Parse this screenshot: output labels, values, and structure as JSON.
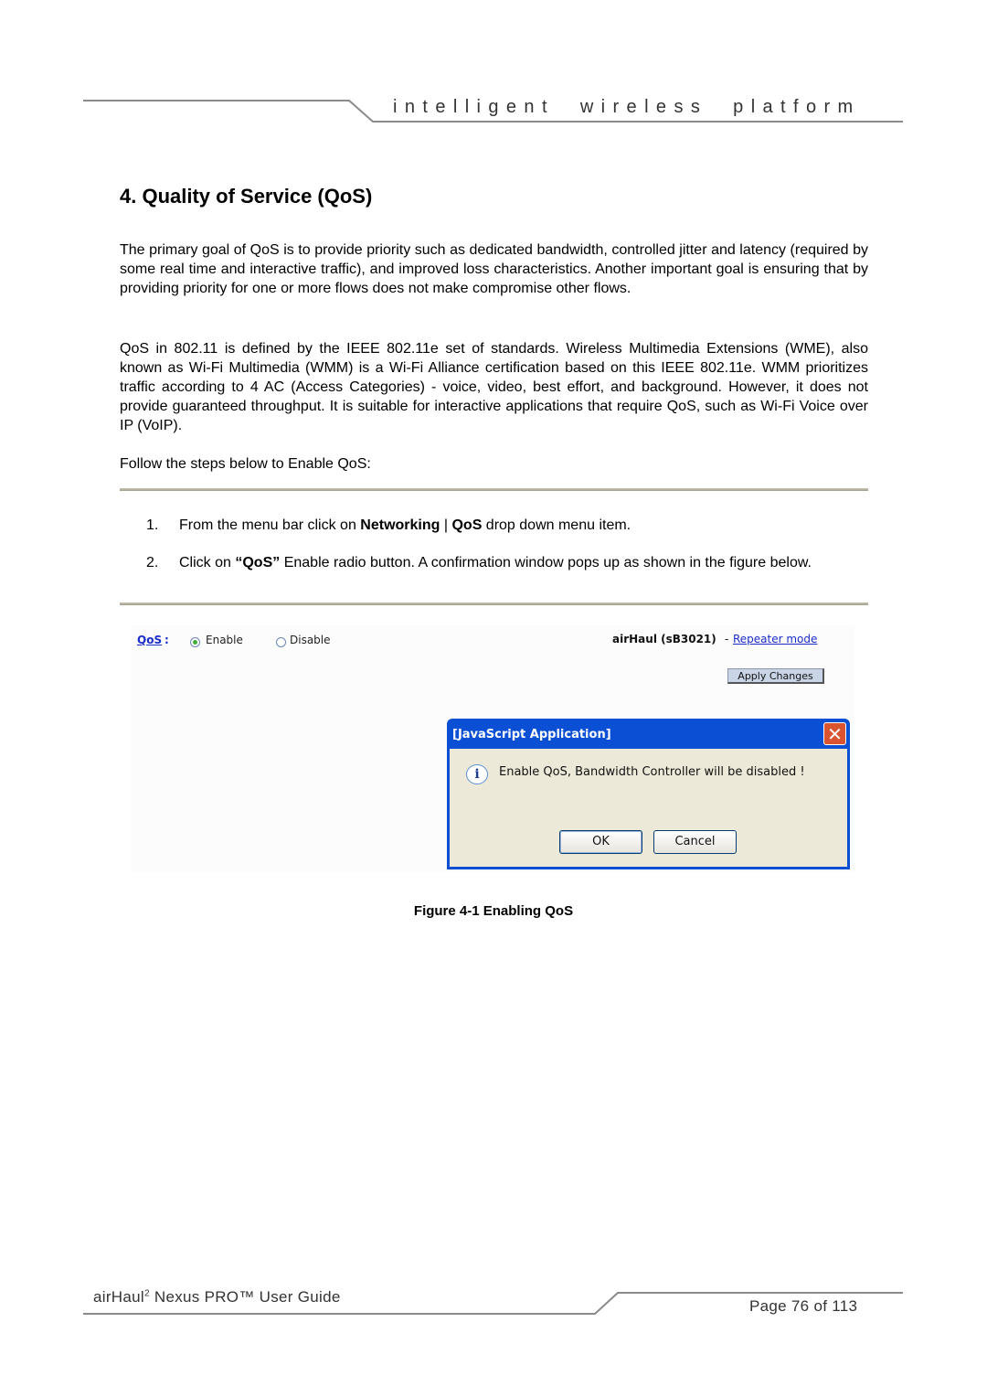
{
  "header": {
    "tagline": "intelligent  wireless  platform"
  },
  "section": {
    "title": "4. Quality of Service (QoS)",
    "paragraphs": [
      "The primary goal of QoS is to provide priority such as dedicated bandwidth, controlled jitter and latency (required by some real time and interactive traffic), and improved loss characteristics. Another important goal is ensuring that by providing priority for one or more flows does not make compromise other flows.",
      "QoS in 802.11 is defined by the IEEE 802.11e set of standards. Wireless Multimedia Extensions (WME), also known as Wi-Fi Multimedia (WMM) is a Wi-Fi Alliance certification based on this IEEE 802.11e. WMM prioritizes traffic according to 4 AC (Access Categories) - voice, video, best effort, and background. However, it does not provide guaranteed throughput. It is suitable for interactive applications that require QoS, such as Wi-Fi Voice over IP (VoIP).",
      "Follow the steps below to Enable QoS:"
    ],
    "steps": [
      {
        "num": "1.",
        "pre": "From the menu bar click on ",
        "bold1": "Networking",
        "sep": " | ",
        "bold2": "QoS",
        "post": " drop down menu item."
      },
      {
        "num": "2.",
        "pre": "Click on ",
        "bold1": "“QoS”",
        "post": " Enable radio button. A confirmation window pops up as shown in the figure below."
      }
    ]
  },
  "figure": {
    "qos_label": "QoS",
    "colon": ":",
    "options": [
      {
        "label": "Enable",
        "selected": true
      },
      {
        "label": "Disable",
        "selected": false
      }
    ],
    "device": "airHaul (sB3021)",
    "dash": "-",
    "mode_link": "Repeater mode",
    "apply_button": "Apply Changes",
    "dialog": {
      "title": "[JavaScript Application]",
      "close_glyph": "✕",
      "info_glyph": "i",
      "message": "Enable QoS, Bandwidth Controller will be disabled !",
      "ok": "OK",
      "cancel": "Cancel"
    },
    "caption": "Figure 4-1 Enabling QoS"
  },
  "footer": {
    "guide_pre": "airHaul",
    "guide_sup": "2",
    "guide_post": " Nexus PRO™ User Guide",
    "page": "Page 76 of 113"
  }
}
